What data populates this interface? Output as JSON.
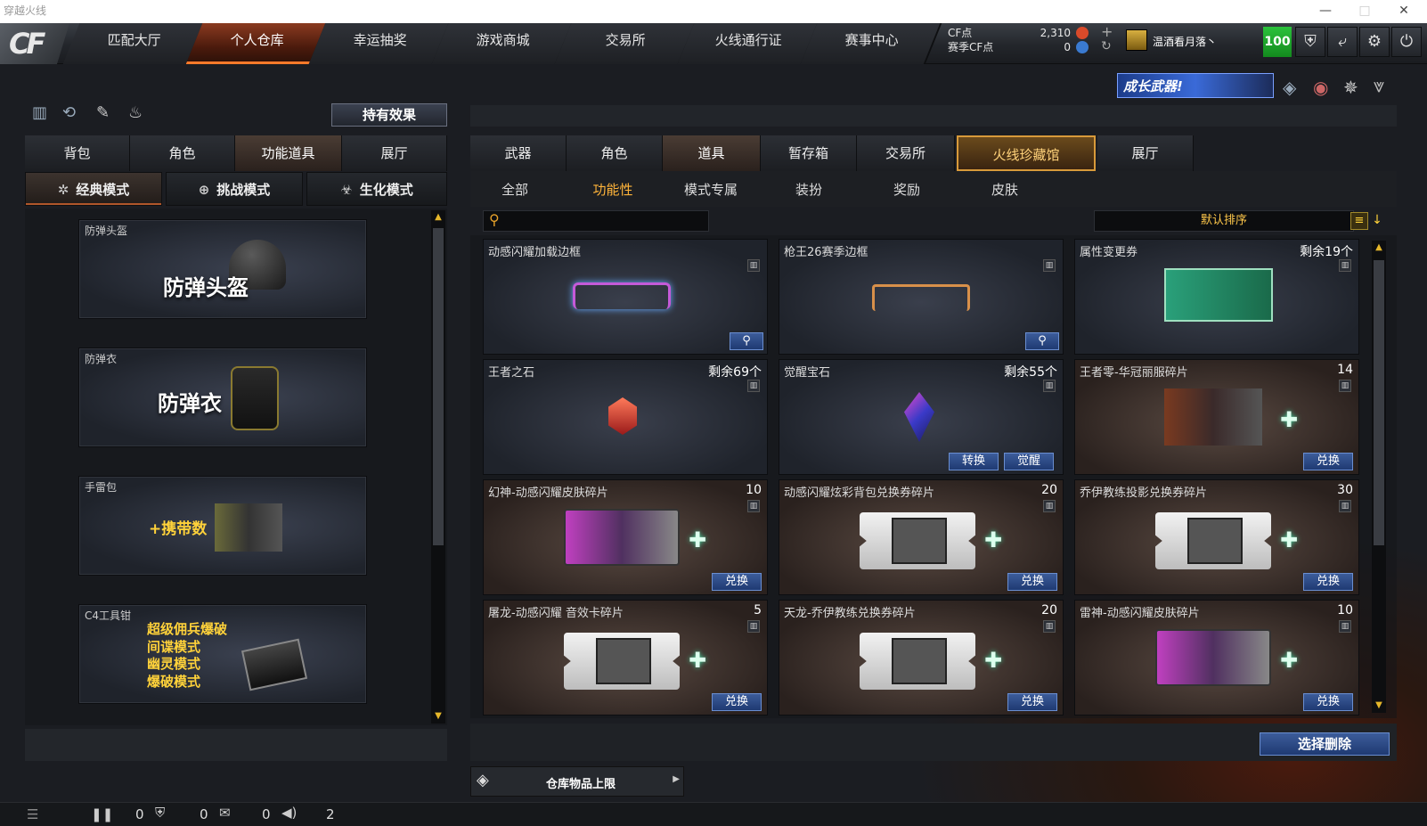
{
  "window": {
    "title": "穿越火线"
  },
  "nav": {
    "tabs": [
      {
        "label": "匹配大厅"
      },
      {
        "label": "个人仓库"
      },
      {
        "label": "幸运抽奖"
      },
      {
        "label": "游戏商城"
      },
      {
        "label": "交易所"
      },
      {
        "label": "火线通行证"
      },
      {
        "label": "赛事中心"
      }
    ],
    "active_tab": "个人仓库"
  },
  "currency": {
    "cf_label": "CF点",
    "cf_value": "2,310",
    "season_label": "赛季CF点",
    "season_value": "0"
  },
  "user": {
    "name": "温酒看月落丶",
    "level_badge": "100"
  },
  "banner": {
    "text": "成长武器!"
  },
  "left": {
    "hold_effect_label": "持有效果",
    "tabs": [
      {
        "label": "背包"
      },
      {
        "label": "角色"
      },
      {
        "label": "功能道具"
      },
      {
        "label": "展厅"
      }
    ],
    "modes": [
      {
        "label": "经典模式"
      },
      {
        "label": "挑战模式"
      },
      {
        "label": "生化模式"
      }
    ],
    "cards": [
      {
        "label": "防弹头盔",
        "big": "防弹头盔"
      },
      {
        "label": "防弹衣",
        "big": "防弹衣"
      },
      {
        "label": "手雷包",
        "big": "+携带数"
      },
      {
        "label": "C4工具钳",
        "lines": [
          "超级佣兵爆破",
          "间谍模式",
          "幽灵模式",
          "爆破模式"
        ]
      }
    ]
  },
  "right": {
    "tabs": [
      {
        "label": "武器"
      },
      {
        "label": "角色"
      },
      {
        "label": "道具"
      },
      {
        "label": "暂存箱"
      },
      {
        "label": "交易所"
      },
      {
        "label": "火线珍藏馆"
      },
      {
        "label": "展厅"
      }
    ],
    "filters": [
      {
        "label": "全部"
      },
      {
        "label": "功能性"
      },
      {
        "label": "模式专属"
      },
      {
        "label": "装扮"
      },
      {
        "label": "奖励"
      },
      {
        "label": "皮肤"
      }
    ],
    "sort_label": "默认排序",
    "items": [
      {
        "name": "动感闪耀加载边框",
        "count": "",
        "kind": "frame1"
      },
      {
        "name": "枪王26赛季边框",
        "count": "",
        "kind": "frame2"
      },
      {
        "name": "属性变更券",
        "count": "剩余19个",
        "kind": "card"
      },
      {
        "name": "王者之石",
        "count": "剩余69个",
        "kind": "ruby"
      },
      {
        "name": "觉醒宝石",
        "count": "剩余55个",
        "kind": "gem",
        "btn1": "转换",
        "btn2": "觉醒"
      },
      {
        "name": "王者零-华冠丽服碎片",
        "count": "14",
        "kind": "chars",
        "btn1": "兑换"
      },
      {
        "name": "幻神-动感闪耀皮肤碎片",
        "count": "10",
        "kind": "skin",
        "btn1": "兑换"
      },
      {
        "name": "动感闪耀炫彩背包兑换券碎片",
        "count": "20",
        "kind": "ticket",
        "btn1": "兑换"
      },
      {
        "name": "乔伊教练投影兑换券碎片",
        "count": "30",
        "kind": "ticket",
        "btn1": "兑换"
      },
      {
        "name": "屠龙-动感闪耀 音效卡碎片",
        "count": "5",
        "kind": "ticket",
        "btn1": "兑换"
      },
      {
        "name": "天龙-乔伊教练兑换券碎片",
        "count": "20",
        "kind": "ticket",
        "btn1": "兑换"
      },
      {
        "name": "雷神-动感闪耀皮肤碎片",
        "count": "10",
        "kind": "skin",
        "btn1": "兑换"
      }
    ],
    "select_delete": "选择删除",
    "capacity_label": "仓库物品上限"
  },
  "bottom": {
    "counts": [
      "0",
      "0",
      "0",
      "2"
    ]
  }
}
